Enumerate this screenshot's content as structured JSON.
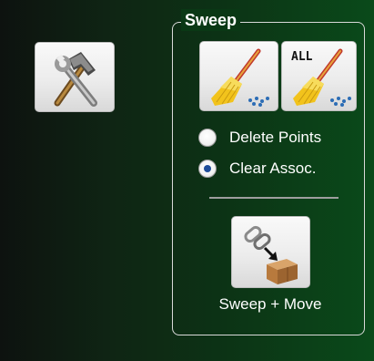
{
  "tools": {
    "icon": "hammer-wrench-icon"
  },
  "sweep": {
    "title": "Sweep",
    "sweep_icon": "broom-icon",
    "sweep_all_icon": "broom-all-icon",
    "sweep_all_badge": "ALL",
    "options": [
      {
        "label": "Delete Points",
        "selected": false
      },
      {
        "label": "Clear Assoc.",
        "selected": true
      }
    ],
    "sweep_move": {
      "icon": "link-to-box-icon",
      "label": "Sweep + Move"
    }
  },
  "colors": {
    "selected_radio": "#1f4d9a",
    "group_border": "#d9d9d9"
  }
}
